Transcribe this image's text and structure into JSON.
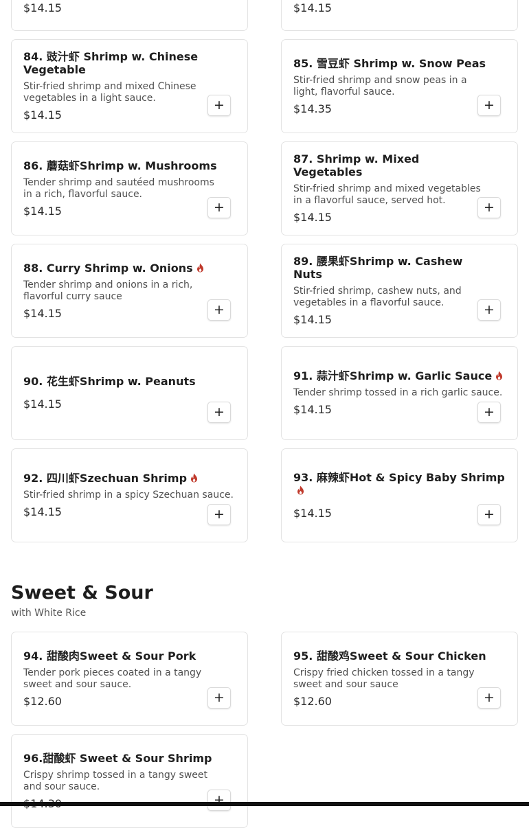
{
  "accent_color": "#c0392b",
  "spicy_icon": "flame-icon",
  "add_icon": "plus-icon",
  "top_cards": [
    {
      "price": "$14.15"
    },
    {
      "price": "$14.15"
    }
  ],
  "items": [
    {
      "title": "84. 豉汁虾 Shrimp w. Chinese Vegetable",
      "description": "Stir-fried shrimp and mixed Chinese vegetables in a light sauce.",
      "price": "$14.15",
      "spicy": false
    },
    {
      "title": "85. 雪豆虾 Shrimp w. Snow Peas",
      "description": "Stir-fried shrimp and snow peas in a light, flavorful sauce.",
      "price": "$14.35",
      "spicy": false
    },
    {
      "title": "86. 蘑菇虾Shrimp w. Mushrooms",
      "description": "Tender shrimp and sautéed mushrooms in a rich, flavorful sauce.",
      "price": "$14.15",
      "spicy": false
    },
    {
      "title": "87. Shrimp w. Mixed Vegetables",
      "description": "Stir-fried shrimp and mixed vegetables in a flavorful sauce, served hot.",
      "price": "$14.15",
      "spicy": false
    },
    {
      "title": "88. Curry Shrimp w. Onions",
      "description": "Tender shrimp and onions in a rich, flavorful curry sauce",
      "price": "$14.15",
      "spicy": true
    },
    {
      "title": "89. 腰果虾Shrimp w. Cashew Nuts",
      "description": "Stir-fried shrimp, cashew nuts, and vegetables in a flavorful sauce.",
      "price": "$14.15",
      "spicy": false
    },
    {
      "title": "90. 花生虾Shrimp w. Peanuts",
      "description": "",
      "price": "$14.15",
      "spicy": false
    },
    {
      "title": "91. 蒜汁虾Shrimp w. Garlic Sauce",
      "description": "Tender shrimp tossed in a rich garlic sauce.",
      "price": "$14.15",
      "spicy": true
    },
    {
      "title": "92. 四川虾Szechuan Shrimp",
      "description": "Stir-fried shrimp in a spicy Szechuan sauce.",
      "price": "$14.15",
      "spicy": true
    },
    {
      "title": "93. 麻辣虾Hot & Spicy Baby Shrimp",
      "description": "",
      "price": "$14.15",
      "spicy": true
    }
  ],
  "section": {
    "title": "Sweet & Sour",
    "subtitle": "with White Rice",
    "items": [
      {
        "title": "94. 甜酸肉Sweet & Sour Pork",
        "description": "Tender pork pieces coated in a tangy sweet and sour sauce.",
        "price": "$12.60",
        "spicy": false
      },
      {
        "title": "95. 甜酸鸡Sweet & Sour Chicken",
        "description": "Crispy fried chicken tossed in a tangy sweet and sour sauce",
        "price": "$12.60",
        "spicy": false
      },
      {
        "title": "96.甜酸虾 Sweet & Sour Shrimp",
        "description": "Crispy shrimp tossed in a tangy sweet and sour sauce.",
        "price": "$14.30",
        "spicy": false
      }
    ]
  }
}
